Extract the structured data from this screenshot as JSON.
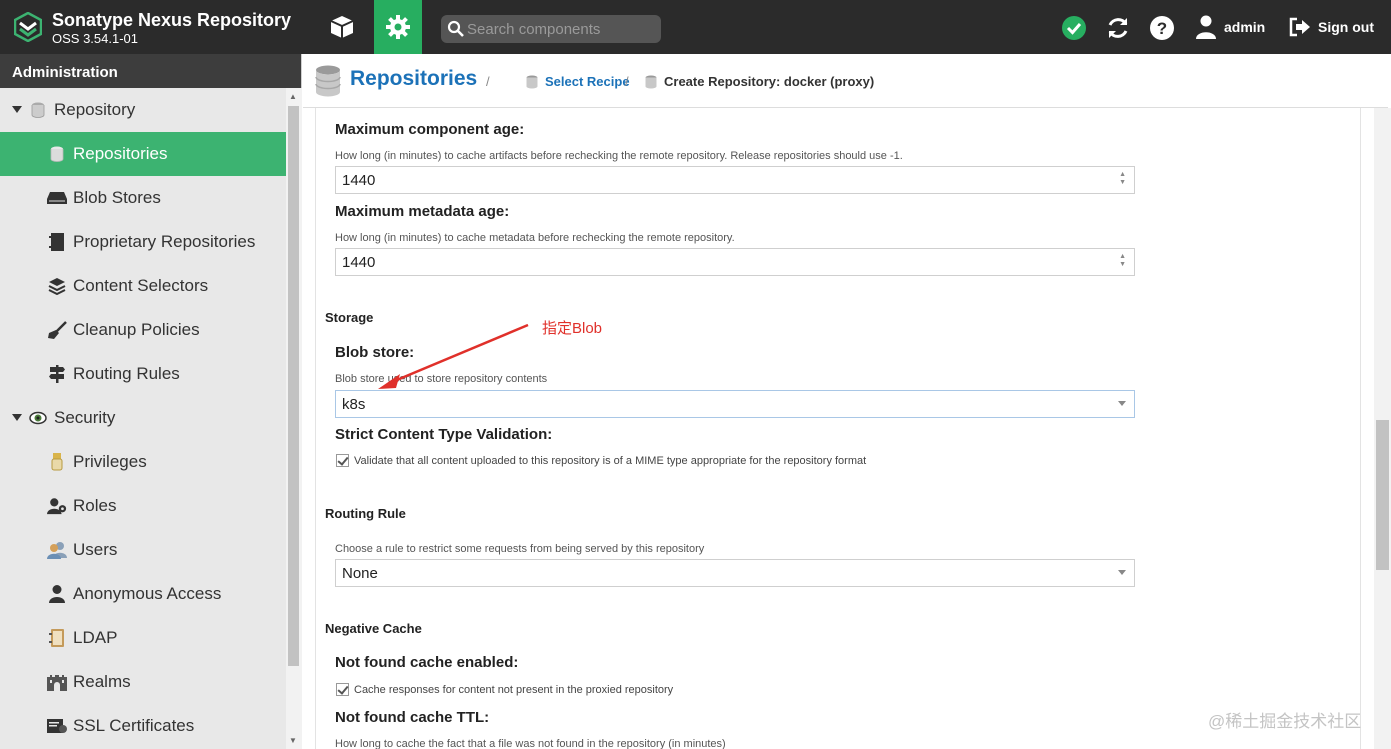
{
  "header": {
    "title": "Sonatype Nexus Repository",
    "version": "OSS 3.54.1-01",
    "search_placeholder": "Search components",
    "user": "admin",
    "sign_out": "Sign out"
  },
  "sidebar": {
    "heading": "Administration",
    "items": [
      {
        "label": "Repository",
        "type": "group",
        "icon": "database-icon"
      },
      {
        "label": "Repositories",
        "type": "child",
        "active": true,
        "icon": "database-icon"
      },
      {
        "label": "Blob Stores",
        "type": "child",
        "icon": "hdd-icon"
      },
      {
        "label": "Proprietary Repositories",
        "type": "child",
        "icon": "book-icon"
      },
      {
        "label": "Content Selectors",
        "type": "child",
        "icon": "layers-icon"
      },
      {
        "label": "Cleanup Policies",
        "type": "child",
        "icon": "broom-icon"
      },
      {
        "label": "Routing Rules",
        "type": "child",
        "icon": "signpost-icon"
      },
      {
        "label": "Security",
        "type": "group",
        "icon": "eye-icon"
      },
      {
        "label": "Privileges",
        "type": "child",
        "icon": "medal-icon"
      },
      {
        "label": "Roles",
        "type": "child",
        "icon": "user-tie-icon"
      },
      {
        "label": "Users",
        "type": "child",
        "icon": "users-icon"
      },
      {
        "label": "Anonymous Access",
        "type": "child",
        "icon": "user-icon"
      },
      {
        "label": "LDAP",
        "type": "child",
        "icon": "address-book-icon"
      },
      {
        "label": "Realms",
        "type": "child",
        "icon": "castle-icon"
      },
      {
        "label": "SSL Certificates",
        "type": "child",
        "icon": "certificate-icon"
      }
    ]
  },
  "breadcrumb": {
    "title": "Repositories",
    "sep": "/",
    "select_recipe": "Select Recipe",
    "current": "Create Repository: docker (proxy)"
  },
  "form": {
    "max_component_age": {
      "label": "Maximum component age:",
      "help": "How long (in minutes) to cache artifacts before rechecking the remote repository. Release repositories should use -1.",
      "value": "1440"
    },
    "max_metadata_age": {
      "label": "Maximum metadata age:",
      "help": "How long (in minutes) to cache metadata before rechecking the remote repository.",
      "value": "1440"
    },
    "storage_section": "Storage",
    "blob_store": {
      "label": "Blob store:",
      "help": "Blob store used to store repository contents",
      "value": "k8s"
    },
    "strict_validation": {
      "label": "Strict Content Type Validation:",
      "checkbox": "Validate that all content uploaded to this repository is of a MIME type appropriate for the repository format",
      "checked": true
    },
    "routing_section": "Routing Rule",
    "routing_rule": {
      "help": "Choose a rule to restrict some requests from being served by this repository",
      "value": "None"
    },
    "negative_cache_section": "Negative Cache",
    "not_found_enabled": {
      "label": "Not found cache enabled:",
      "checkbox": "Cache responses for content not present in the proxied repository",
      "checked": true
    },
    "not_found_ttl": {
      "label": "Not found cache TTL:",
      "help": "How long to cache the fact that a file was not found in the repository (in minutes)"
    }
  },
  "annotation": "指定Blob",
  "watermark": "@稀土掘金技术社区",
  "colors": {
    "header_bg": "#2b2b2b",
    "admin_accent": "#27ae60",
    "active_item": "#3cb371",
    "link": "#1c72b8",
    "annotation": "#e0302a"
  }
}
